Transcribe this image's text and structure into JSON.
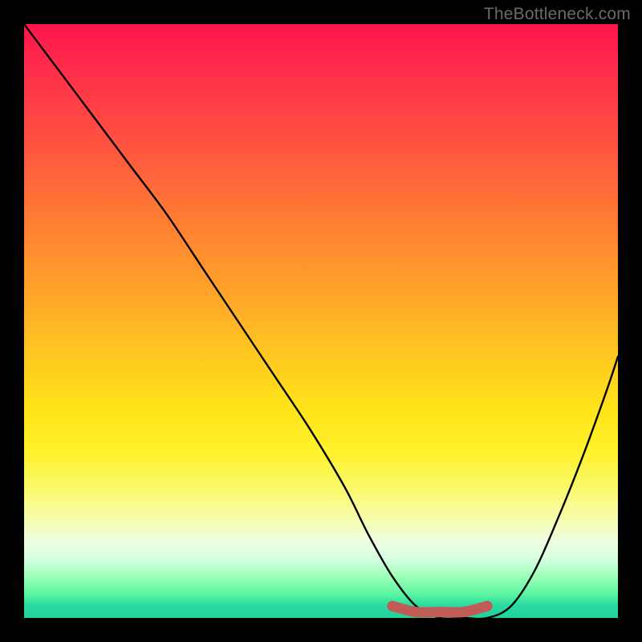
{
  "watermark": "TheBottleneck.com",
  "chart_data": {
    "type": "line",
    "title": "",
    "xlabel": "",
    "ylabel": "",
    "xlim": [
      0,
      100
    ],
    "ylim": [
      0,
      100
    ],
    "series": [
      {
        "name": "bottleneck-curve",
        "x": [
          0,
          6,
          12,
          18,
          24,
          30,
          36,
          42,
          48,
          54,
          58,
          62,
          66,
          70,
          74,
          78,
          82,
          86,
          90,
          94,
          98,
          100
        ],
        "values": [
          100,
          92,
          84,
          76,
          68,
          59,
          50,
          41,
          32,
          22,
          14,
          7,
          2,
          0,
          0,
          0,
          2,
          8,
          17,
          27,
          38,
          44
        ]
      },
      {
        "name": "bottom-marker",
        "x": [
          62,
          66,
          70,
          74,
          78
        ],
        "values": [
          2,
          1,
          1,
          1,
          2
        ]
      }
    ],
    "colors": {
      "curve": "#000000",
      "marker": "#c15b55",
      "gradient_top": "#ff154d",
      "gradient_bottom": "#1fd39e"
    }
  }
}
